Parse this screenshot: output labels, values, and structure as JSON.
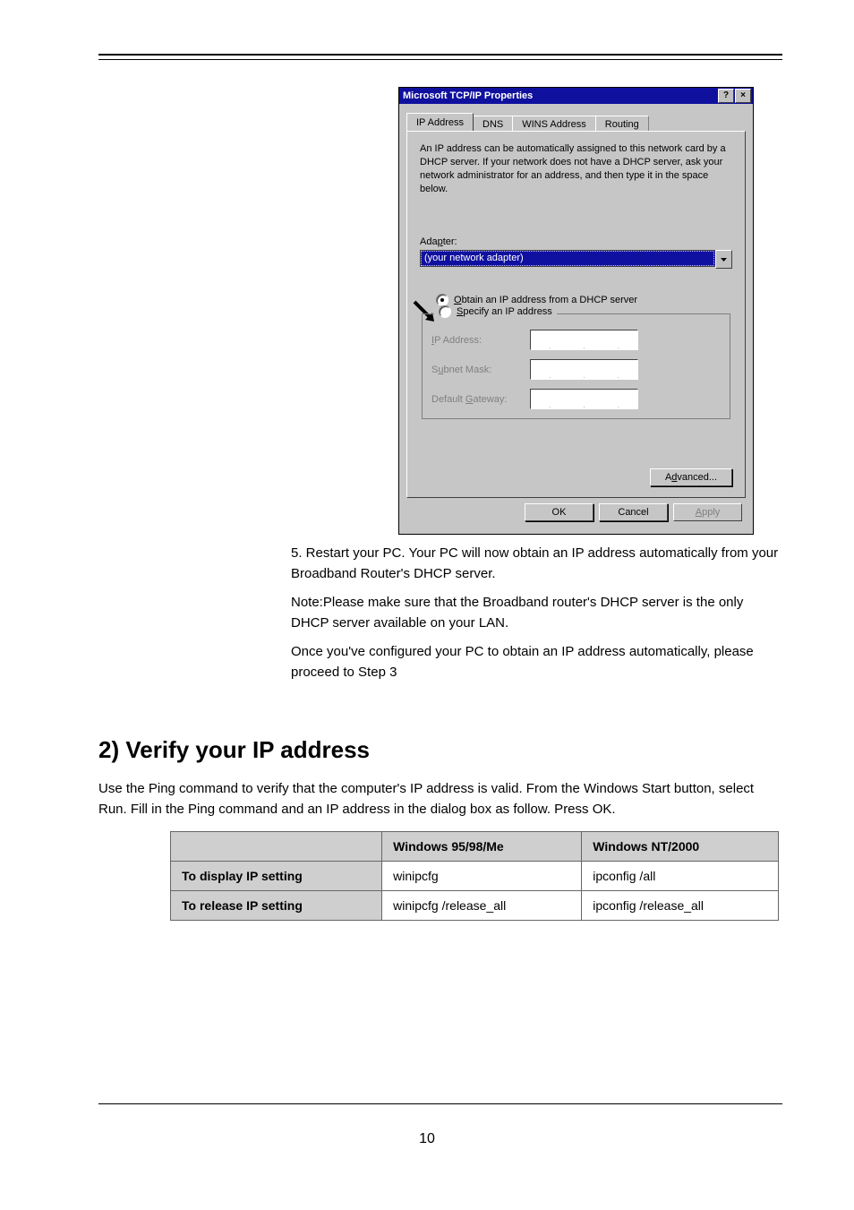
{
  "dialog": {
    "title": "Microsoft TCP/IP Properties",
    "help_glyph": "?",
    "close_glyph": "×",
    "tabs": [
      "IP Address",
      "DNS",
      "WINS Address",
      "Routing"
    ],
    "intro": "An IP address can be automatically assigned to this network card by a DHCP server.  If your network does not have a DHCP server, ask your network administrator for an address, and then type it in the space below.",
    "adapter_label": "Adapter:",
    "adapter_value": "(your network adapter)",
    "radio_dhcp_pre": "O",
    "radio_dhcp_rest": "btain an IP address from a DHCP server",
    "radio_specify_pre": "S",
    "radio_specify_rest": "pecify an IP address",
    "field_ip": "IP Address:",
    "field_mask": "Subnet Mask:",
    "field_gw": "Default Gateway:",
    "advanced_pre": "A",
    "advanced_u": "d",
    "advanced_post": "vanced...",
    "ok": "OK",
    "cancel": "Cancel",
    "apply_pre": "A",
    "apply_rest": "pply"
  },
  "steps": {
    "s5": "5. Restart your PC. Your PC will now obtain an IP address automatically from your Broadband Router's DHCP server.",
    "note": "Note:Please make sure that the Broadband router's DHCP server is the only DHCP server available on your LAN.",
    "s6": "Once you've configured your PC to obtain an IP address automatically, please proceed to Step 3"
  },
  "section": {
    "heading": "2) Verify your IP address",
    "para": "Use the Ping command to verify that the computer's IP address is valid. From the Windows Start button, select Run. Fill in the Ping command and an IP address in the dialog box as follow. Press OK."
  },
  "table": {
    "headers": [
      "",
      "Windows 95/98/Me",
      "Windows NT/2000"
    ],
    "rows": [
      [
        "To display IP setting",
        "winipcfg",
        "ipconfig /all"
      ],
      [
        "To release IP setting",
        "winipcfg /release_all",
        "ipconfig /release_all"
      ]
    ]
  },
  "page_number": "10"
}
